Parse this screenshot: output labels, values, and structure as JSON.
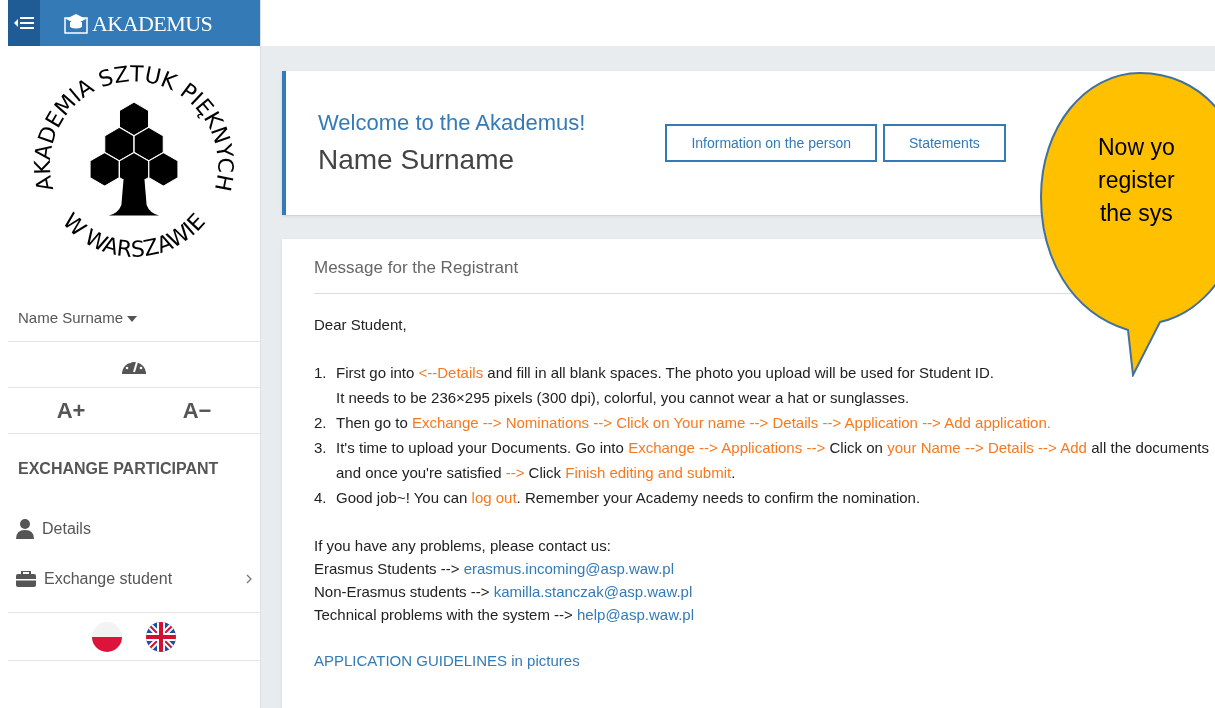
{
  "topbar": {
    "brand": "AKADEMUS"
  },
  "sidebar": {
    "logo_top": "AKADEMIA SZTUK PIĘKNYCH",
    "logo_bottom": "W WARSZAWIE",
    "user": "Name Surname",
    "font_up": "A+",
    "font_down": "A−",
    "section": "EXCHANGE PARTICIPANT",
    "items": [
      {
        "label": "Details",
        "kind": "person",
        "expandable": false
      },
      {
        "label": "Exchange student",
        "kind": "case",
        "expandable": true
      }
    ],
    "languages": [
      {
        "kind": "pl"
      },
      {
        "kind": "en"
      }
    ]
  },
  "header": {
    "welcome": "Welcome to the Akademus!",
    "name": "Name Surname",
    "buttons": [
      "Information on the person",
      "Statements"
    ]
  },
  "message": {
    "title": "Message for the Registrant",
    "greeting": "Dear Student,",
    "steps": [
      {
        "number": "1.",
        "lines": [
          [
            {
              "kind": "plain",
              "text": "First go into "
            },
            {
              "kind": "link",
              "text": "<--Details"
            },
            {
              "kind": "plain",
              "text": " and fill in all blank spaces. The photo you upload will be used for Student ID."
            }
          ],
          [
            {
              "kind": "plain",
              "text": "It needs to be 236×295 pixels (300 dpi), colorful, you cannot wear a hat or sunglasses."
            }
          ]
        ]
      },
      {
        "number": "2.",
        "lines": [
          [
            {
              "kind": "plain",
              "text": "Then go to "
            },
            {
              "kind": "link",
              "text": "Exchange --> Nominations --> Click on Your name --> Details --> Application --> Add application."
            }
          ]
        ]
      },
      {
        "number": "3.",
        "lines": [
          [
            {
              "kind": "plain",
              "text": "It's time to upload your Documents. Go into "
            },
            {
              "kind": "link",
              "text": "Exchange --> Applications -->"
            },
            {
              "kind": "plain",
              "text": " Click on "
            },
            {
              "kind": "link",
              "text": "your Name --> Details --> Add"
            },
            {
              "kind": "plain",
              "text": " all the documents and once you're satisfied "
            },
            {
              "kind": "link",
              "text": "-->"
            },
            {
              "kind": "plain",
              "text": " Click "
            },
            {
              "kind": "link",
              "text": "Finish editing and submit"
            },
            {
              "kind": "plain",
              "text": "."
            }
          ]
        ]
      },
      {
        "number": "4.",
        "lines": [
          [
            {
              "kind": "plain",
              "text": "Good job~! You can "
            },
            {
              "kind": "link",
              "text": "log out"
            },
            {
              "kind": "plain",
              "text": ". Remember your Academy needs to confirm the nomination."
            }
          ]
        ]
      }
    ],
    "contact_intro": "If you have any problems, please contact us:",
    "contacts": [
      {
        "label": "Erasmus Students -->",
        "email": "erasmus.incoming@asp.waw.pl"
      },
      {
        "label": "Non-Erasmus students -->",
        "email": "kamilla.stanczak@asp.waw.pl"
      },
      {
        "label": "Technical problems with the system -->",
        "email": "help@asp.waw.pl"
      }
    ],
    "guidelines": "APPLICATION GUIDELINES in pictures"
  },
  "callout": {
    "lines": [
      "Now yo",
      "register",
      "the sys"
    ]
  }
}
